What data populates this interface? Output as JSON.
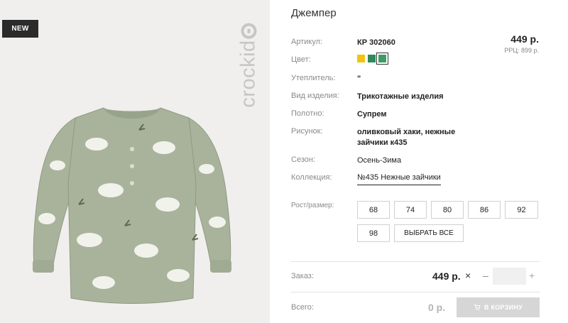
{
  "product": {
    "badge": "NEW",
    "brand": "crockid",
    "title": "Джемпер",
    "price": "449 р.",
    "rrp": "РРЦ: 899 р."
  },
  "specs": [
    {
      "label": "Артикул:",
      "value": "КР 302060"
    },
    {
      "label": "Цвет:",
      "value": ""
    },
    {
      "label": "Утеплитель:",
      "value": "\""
    },
    {
      "label": "Вид изделия:",
      "value": "Трикотажные изделия"
    },
    {
      "label": "Полотно:",
      "value": "Супрем"
    },
    {
      "label": "Рисунок:",
      "value": "оливковый хаки, нежные зайчики к435"
    },
    {
      "label": "Сезон:",
      "value": "Осень-Зима"
    },
    {
      "label": "Коллекция:",
      "value": "№435 Нежные зайчики"
    }
  ],
  "colors": {
    "swatch_1": "#f1c40f",
    "swatch_2": "#2e8b57",
    "swatch_3": "#3f9a66",
    "garment": "#a9b39c"
  },
  "sizes": {
    "label": "Рост/размер:",
    "options": [
      "68",
      "74",
      "80",
      "86",
      "92",
      "98"
    ],
    "select_all": "ВЫБРАТЬ ВСЕ"
  },
  "order": {
    "label": "Заказ:",
    "price": "449 р.",
    "times_icon": "×",
    "minus_icon": "–",
    "plus_icon": "+",
    "quantity": ""
  },
  "total": {
    "label": "Всего:",
    "value": "0 р.",
    "cart_icon": "cart-icon",
    "cart_button": "В КОРЗИНУ"
  }
}
